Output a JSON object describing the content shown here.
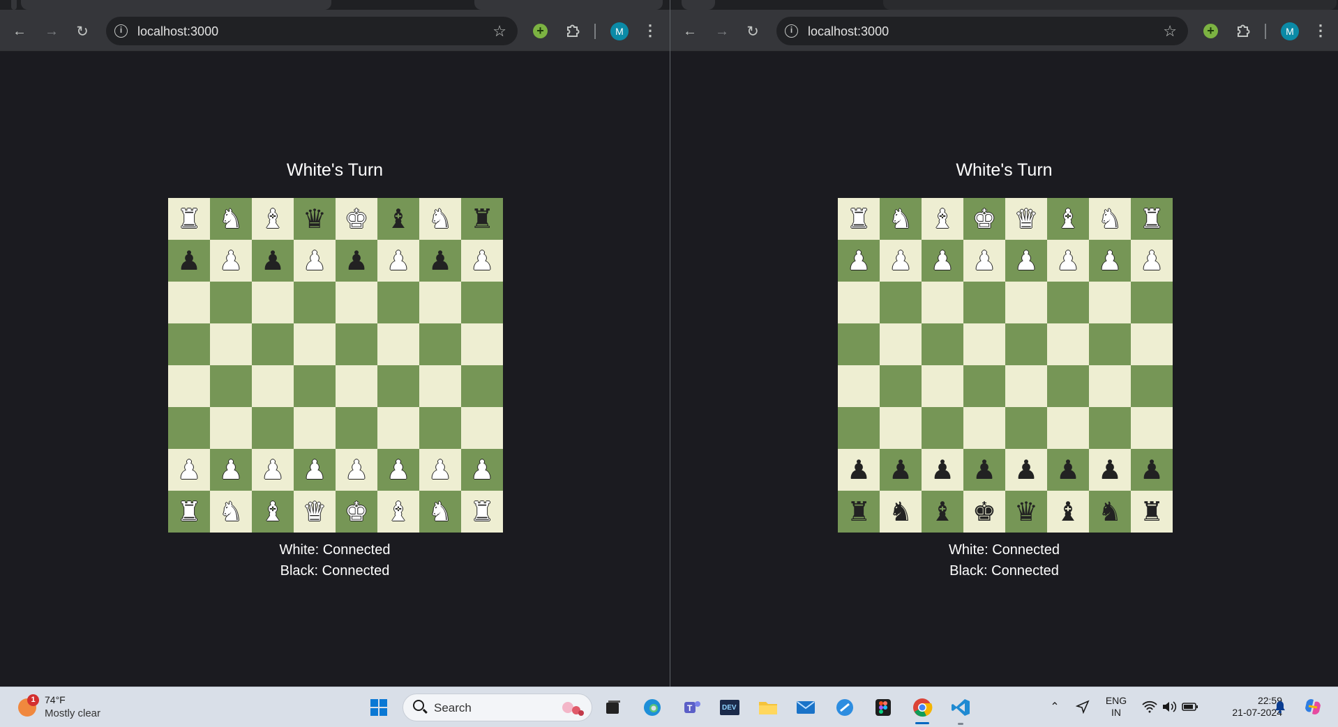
{
  "browser_left": {
    "url": "localhost:3000",
    "profile_initial": "M",
    "game": {
      "turn_text": "White's Turn",
      "white_status": "White: Connected",
      "black_status": "Black: Connected",
      "orientation": "black-at-bottom",
      "rows": [
        [
          "wR",
          "wN",
          "wB",
          "bQ",
          "wK",
          "bB",
          "wN",
          "bR"
        ],
        [
          "bP",
          "wP",
          "bP",
          "wP",
          "bP",
          "wP",
          "bP",
          "wP"
        ],
        [
          "",
          "",
          "",
          "",
          "",
          "",
          "",
          ""
        ],
        [
          "",
          "",
          "",
          "",
          "",
          "",
          "",
          ""
        ],
        [
          "",
          "",
          "",
          "",
          "",
          "",
          "",
          ""
        ],
        [
          "",
          "",
          "",
          "",
          "",
          "",
          "",
          ""
        ],
        [
          "wP",
          "wP",
          "wP",
          "wP",
          "wP",
          "wP",
          "wP",
          "wP"
        ],
        [
          "wR",
          "wN",
          "wB",
          "wQ",
          "wK",
          "wB",
          "wN",
          "wR"
        ]
      ]
    }
  },
  "browser_right": {
    "url": "localhost:3000",
    "profile_initial": "M",
    "game": {
      "turn_text": "White's Turn",
      "white_status": "White: Connected",
      "black_status": "Black: Connected",
      "orientation": "white-at-top",
      "rows": [
        [
          "wR",
          "wN",
          "wB",
          "wK",
          "wQ",
          "wB",
          "wN",
          "wR"
        ],
        [
          "wP",
          "wP",
          "wP",
          "wP",
          "wP",
          "wP",
          "wP",
          "wP"
        ],
        [
          "",
          "",
          "",
          "",
          "",
          "",
          "",
          ""
        ],
        [
          "",
          "",
          "",
          "",
          "",
          "",
          "",
          ""
        ],
        [
          "",
          "",
          "",
          "",
          "",
          "",
          "",
          ""
        ],
        [
          "",
          "",
          "",
          "",
          "",
          "",
          "",
          ""
        ],
        [
          "bP",
          "bP",
          "bP",
          "bP",
          "bP",
          "bP",
          "bP",
          "bP"
        ],
        [
          "bR",
          "bN",
          "bB",
          "bK",
          "bQ",
          "bB",
          "bN",
          "bR"
        ]
      ]
    }
  },
  "board_colors": {
    "light": "#eeeed2",
    "dark": "#769656"
  },
  "piece_glyphs": {
    "K": "♚",
    "Q": "♛",
    "R": "♜",
    "B": "♝",
    "N": "♞",
    "P": "♟"
  },
  "taskbar": {
    "weather": {
      "temp": "74°F",
      "desc": "Mostly clear",
      "badge": "1"
    },
    "search_label": "Search",
    "apps": [
      "file-explorer-tile",
      "edge",
      "teams",
      "dev-home",
      "file-explorer",
      "mail",
      "ms-paint",
      "figma",
      "chrome",
      "vscode"
    ],
    "language": {
      "line1": "ENG",
      "line2": "IN"
    },
    "clock": {
      "time": "22:59",
      "date": "21-07-2024"
    },
    "accent": "#0067c0"
  }
}
